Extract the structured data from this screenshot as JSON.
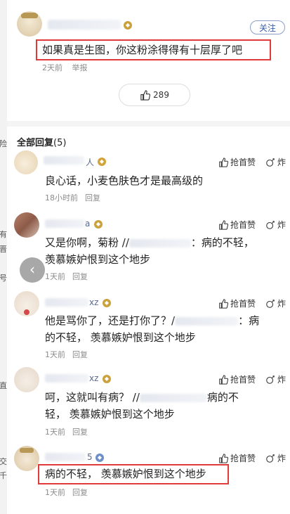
{
  "post": {
    "follow_label": "关注",
    "text": "如果真是生图，你这粉涂得得有十层厚了吧",
    "time": "2天前",
    "report": "举报",
    "likes": "289"
  },
  "replies_header": {
    "title": "全部回复",
    "count": "(5)"
  },
  "replies": [
    {
      "name_suffix": "人",
      "text": "良心话，小麦色肤色才是最高级的",
      "time": "18小时前",
      "reply": "回复",
      "like": "抢首赞",
      "fry": "炸"
    },
    {
      "name_suffix": "a",
      "text_a": "又是你啊，菊粉 //",
      "text_b": "：病的不轻，",
      "text_c": "羡慕嫉妒恨到这个地步",
      "time": "1天前",
      "reply": "回复",
      "like": "抢首赞",
      "fry": "炸"
    },
    {
      "name_suffix": "xz",
      "text_a": "他是骂你了，还是打你了？/",
      "text_b": "：病",
      "text_c": "的不轻，  羡慕嫉妒恨到这个地步",
      "time": "1天前",
      "reply": "回复",
      "like": "抢首赞",
      "fry": "炸"
    },
    {
      "name_suffix": "xz",
      "text_a": "呵，这就叫有病？ //",
      "text_b": "病的不",
      "text_c": "轻，  羡慕嫉妒恨到这个地步",
      "time": "1天前",
      "reply": "回复",
      "like": "抢首赞",
      "fry": "炸"
    },
    {
      "name_suffix": "5",
      "text": "病的不轻，  羡慕嫉妒恨到这个地步",
      "time": "1天前",
      "reply": "回复",
      "like": "抢首赞",
      "fry": "炸"
    }
  ],
  "left_edge": [
    "险",
    "有",
    "晋",
    "号",
    "直",
    "交",
    "千"
  ],
  "colors": {
    "accent_red": "#e03a3a",
    "follow_blue": "#3a5ea8",
    "meta_gray": "#8c8c8c"
  }
}
